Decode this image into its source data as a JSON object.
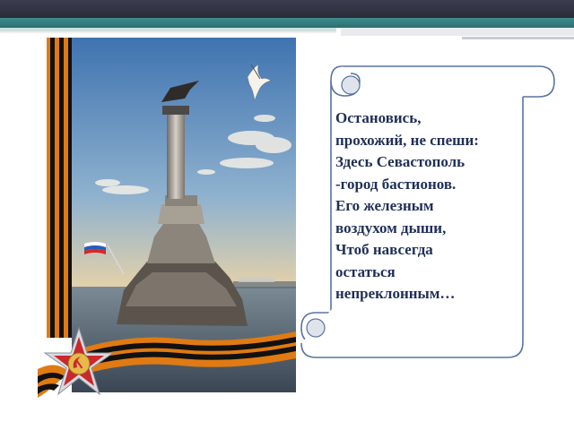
{
  "poem": {
    "lines": [
      "Остановись,",
      "прохожий, не спеши:",
      "Здесь Севастополь",
      "-город бастионов.",
      "Его железным",
      "воздухом дыши,",
      "Чтоб навсегда",
      "остаться",
      "непреклонным…"
    ]
  },
  "photo": {
    "subject": "Monument to the Scuttled Ships",
    "icons": [
      "russian-flag-icon",
      "seagull-icon",
      "order-star-icon",
      "hammer-sickle-icon"
    ]
  },
  "colors": {
    "poem_text": "#1f2f57",
    "scroll_outline": "#5a73a0",
    "ribbon_orange": "#e07a12",
    "ribbon_black": "#111111",
    "top_bar_dark": "#2f3241",
    "top_bar_teal": "#347c7e"
  }
}
